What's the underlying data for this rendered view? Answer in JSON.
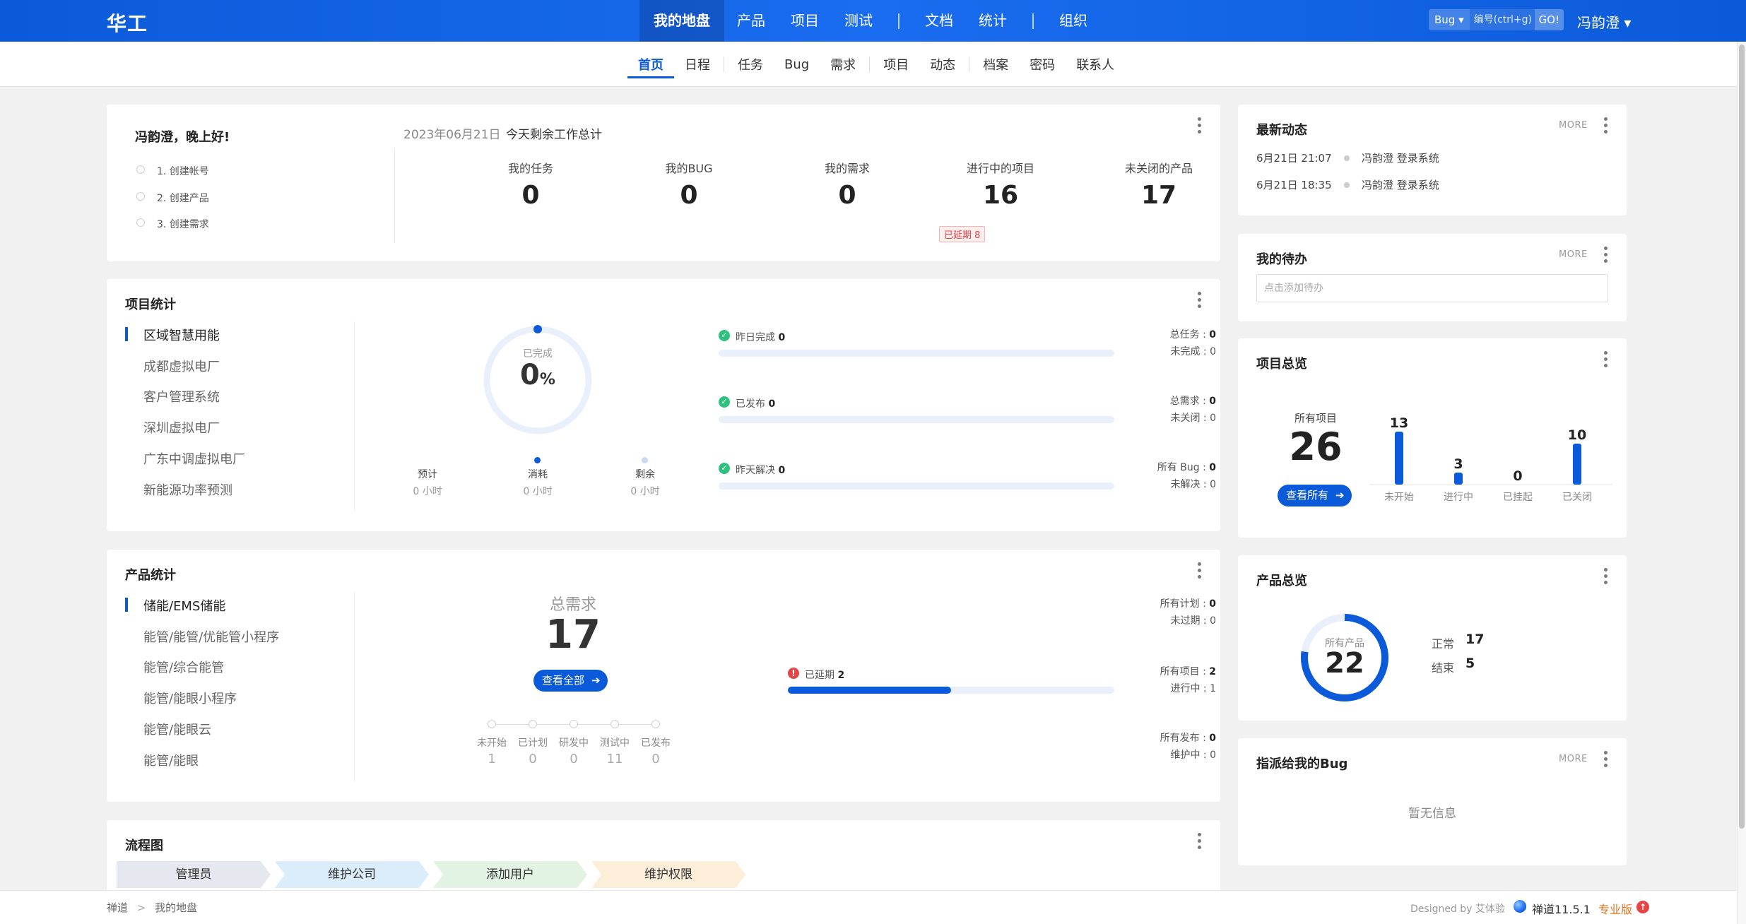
{
  "topbar": {
    "brand": "华工",
    "nav": [
      "我的地盘",
      "产品",
      "项目",
      "测试",
      "文档",
      "统计",
      "组织"
    ],
    "search_type": "Bug ▾",
    "search_placeholder": "编号(ctrl+g)",
    "search_go": "GO!",
    "user": "冯韵澄 ▾"
  },
  "subnav": [
    "首页",
    "日程",
    "任务",
    "Bug",
    "需求",
    "项目",
    "动态",
    "档案",
    "密码",
    "联系人"
  ],
  "welcome": {
    "greeting": "冯韵澄，晚上好!",
    "steps": [
      "1. 创建帐号",
      "2. 创建产品",
      "3. 创建需求"
    ],
    "date": "2023年06月21日",
    "summary_title": "今天剩余工作总计",
    "stats": [
      {
        "label": "我的任务",
        "value": "0"
      },
      {
        "label": "我的BUG",
        "value": "0"
      },
      {
        "label": "我的需求",
        "value": "0"
      },
      {
        "label": "进行中的项目",
        "value": "16"
      },
      {
        "label": "未关闭的产品",
        "value": "17"
      }
    ],
    "delayed_badge": "已延期 8"
  },
  "project_stats": {
    "title": "项目统计",
    "projects": [
      "区域智慧用能",
      "成都虚拟电厂",
      "客户管理系统",
      "深圳虚拟电厂",
      "广东中调虚拟电厂",
      "新能源功率预测"
    ],
    "progress": {
      "label": "已完成",
      "value": "0",
      "unit": "%",
      "fraction": 0
    },
    "hours": [
      {
        "label": "预计",
        "value": "0",
        "unit": "小时"
      },
      {
        "label": "消耗",
        "value": "0",
        "unit": "小时"
      },
      {
        "label": "剩余",
        "value": "0",
        "unit": "小时"
      }
    ],
    "rows": [
      {
        "label": "昨日完成",
        "value": "0",
        "r1_label": "总任务",
        "r1_value": "0",
        "r2_label": "未完成",
        "r2_value": "0"
      },
      {
        "label": "已发布",
        "value": "0",
        "r1_label": "总需求",
        "r1_value": "0",
        "r2_label": "未关闭",
        "r2_value": "0"
      },
      {
        "label": "昨天解决",
        "value": "0",
        "r1_label": "所有 Bug",
        "r1_value": "0",
        "r2_label": "未解决",
        "r2_value": "0"
      }
    ]
  },
  "product_stats": {
    "title": "产品统计",
    "products": [
      "储能/EMS储能",
      "能管/能管/优能管小程序",
      "能管/综合能管",
      "能管/能眼小程序",
      "能管/能眼云",
      "能管/能眼"
    ],
    "total_label": "总需求",
    "total_value": "17",
    "view_all": "查看全部",
    "stages": [
      {
        "label": "未开始",
        "value": "1"
      },
      {
        "label": "已计划",
        "value": "0"
      },
      {
        "label": "研发中",
        "value": "0"
      },
      {
        "label": "测试中",
        "value": "11"
      },
      {
        "label": "已发布",
        "value": "0"
      }
    ],
    "right": [
      {
        "a_label": "所有计划",
        "a_value": "0",
        "b_label": "未过期",
        "b_value": "0"
      },
      {
        "a_label": "所有项目",
        "a_value": "2",
        "b_label": "进行中",
        "b_value": "1"
      },
      {
        "a_label": "所有发布",
        "a_value": "0",
        "b_label": "维护中",
        "b_value": "0"
      }
    ],
    "delayed_label": "已延期",
    "delayed_value": "2",
    "delayed_fraction": 0.5
  },
  "flow": {
    "title": "流程图",
    "steps": [
      "管理员",
      "维护公司",
      "添加用户",
      "维护权限"
    ],
    "colors": [
      "#e5e8ee",
      "#dbecfb",
      "#e2f3e3",
      "#fdeed9"
    ]
  },
  "dynamics": {
    "title": "最新动态",
    "more": "MORE",
    "items": [
      {
        "time": "6月21日 21:07",
        "text": "冯韵澄 登录系统"
      },
      {
        "time": "6月21日 18:35",
        "text": "冯韵澄 登录系统"
      }
    ]
  },
  "todo": {
    "title": "我的待办",
    "more": "MORE",
    "placeholder": "点击添加待办"
  },
  "project_overview": {
    "title": "项目总览",
    "all_label": "所有项目",
    "all_value": "26",
    "view_all": "查看所有",
    "bars": [
      {
        "label": "未开始",
        "value": 13
      },
      {
        "label": "进行中",
        "value": 3
      },
      {
        "label": "已挂起",
        "value": 0
      },
      {
        "label": "已关闭",
        "value": 10
      }
    ]
  },
  "product_overview": {
    "title": "产品总览",
    "all_label": "所有产品",
    "all_value": "22",
    "normal_label": "正常",
    "normal_value": "17",
    "ended_label": "结束",
    "ended_value": "5",
    "normal_fraction": 0.773
  },
  "bugs": {
    "title": "指派给我的Bug",
    "more": "MORE",
    "empty": "暂无信息"
  },
  "footer": {
    "crumb1": "禅道",
    "crumb_sep": ">",
    "crumb2": "我的地盘",
    "designed": "Designed by 艾体验",
    "version": "禅道11.5.1",
    "edition": "专业版"
  },
  "colors": {
    "primary": "#0b5ad9",
    "success": "#2ec27e",
    "danger": "#e54545"
  }
}
